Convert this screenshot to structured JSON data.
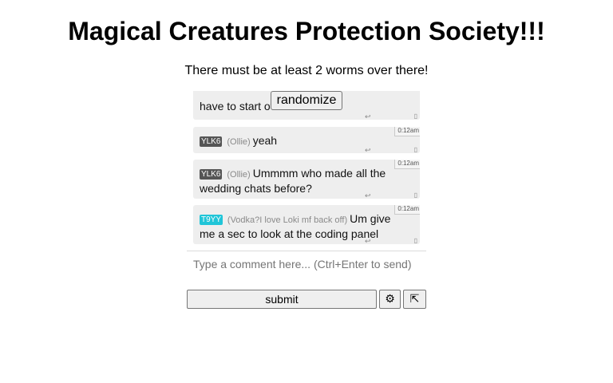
{
  "header": {
    "title": "Magical Creatures Protection Society!!!",
    "subtitle": "There must be at least 2 worms over there!"
  },
  "randomize_label": "randomize",
  "messages": [
    {
      "text": "have to start over",
      "reply_icon": "↩",
      "edit_icon": "▯"
    },
    {
      "time": "0:12am",
      "user_code": "YLK6",
      "user_color": "#555555",
      "nickname": "(Ollie)",
      "text": "yeah",
      "reply_icon": "↩",
      "edit_icon": "▯"
    },
    {
      "time": "0:12am",
      "user_code": "YLK6",
      "user_color": "#555555",
      "nickname": "(Ollie)",
      "text": "Ummmm who made all the wedding chats before?",
      "reply_icon": "↩",
      "edit_icon": "▯"
    },
    {
      "time": "0:12am",
      "user_code": "T9YY",
      "user_color": "#20c5d8",
      "nickname": "(Vodka?I love Loki mf back off)",
      "text": "Um give me a sec to look at the coding panel",
      "reply_icon": "↩",
      "edit_icon": "▯"
    }
  ],
  "composer": {
    "placeholder": "Type a comment here... (Ctrl+Enter to send)",
    "value": "",
    "submit_label": "submit",
    "settings_icon": "⚙",
    "popout_icon": "⇱"
  }
}
